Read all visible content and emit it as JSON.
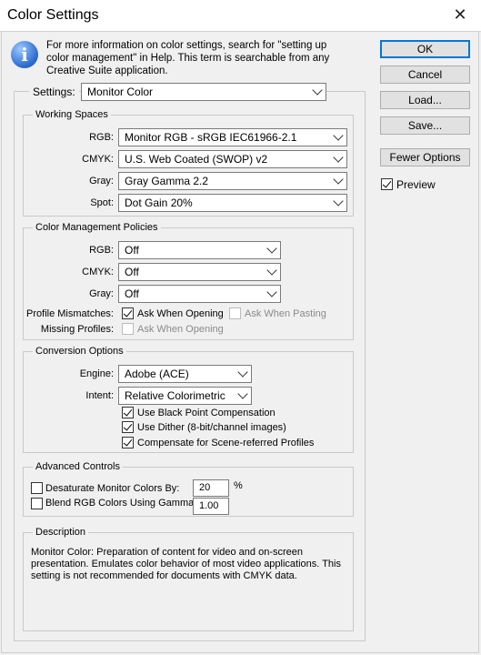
{
  "window": {
    "title": "Color Settings",
    "close_glyph": "✕"
  },
  "info": {
    "icon": "i",
    "text": "For more information on color settings, search for \"setting up color management\" in Help. This term is searchable from any Creative Suite application."
  },
  "buttons": {
    "ok": "OK",
    "cancel": "Cancel",
    "load": "Load...",
    "save": "Save...",
    "fewer": "Fewer Options",
    "preview": "Preview"
  },
  "settings": {
    "label": "Settings:",
    "value": "Monitor Color"
  },
  "working_spaces": {
    "title": "Working Spaces",
    "rgb_label": "RGB:",
    "rgb": "Monitor RGB - sRGB IEC61966-2.1",
    "cmyk_label": "CMYK:",
    "cmyk": "U.S. Web Coated (SWOP) v2",
    "gray_label": "Gray:",
    "gray": "Gray Gamma 2.2",
    "spot_label": "Spot:",
    "spot": "Dot Gain 20%"
  },
  "policies": {
    "title": "Color Management Policies",
    "rgb_label": "RGB:",
    "rgb": "Off",
    "cmyk_label": "CMYK:",
    "cmyk": "Off",
    "gray_label": "Gray:",
    "gray": "Off",
    "mismatch_label": "Profile Mismatches:",
    "ask_opening": "Ask When Opening",
    "ask_pasting": "Ask When Pasting",
    "missing_label": "Missing Profiles:",
    "missing_ask_opening": "Ask When Opening"
  },
  "conversion": {
    "title": "Conversion Options",
    "engine_label": "Engine:",
    "engine": "Adobe (ACE)",
    "intent_label": "Intent:",
    "intent": "Relative Colorimetric",
    "black_point": "Use Black Point Compensation",
    "dither": "Use Dither (8-bit/channel images)",
    "scene": "Compensate for Scene-referred Profiles"
  },
  "advanced": {
    "title": "Advanced Controls",
    "desaturate": "Desaturate Monitor Colors By:",
    "desaturate_value": "20",
    "percent": "%",
    "blend": "Blend RGB Colors Using Gamma:",
    "blend_value": "1.00"
  },
  "description": {
    "title": "Description",
    "text": "Monitor Color:  Preparation of content for video and on-screen presentation. Emulates color behavior of most video applications. This setting is not recommended for documents with CMYK data."
  }
}
